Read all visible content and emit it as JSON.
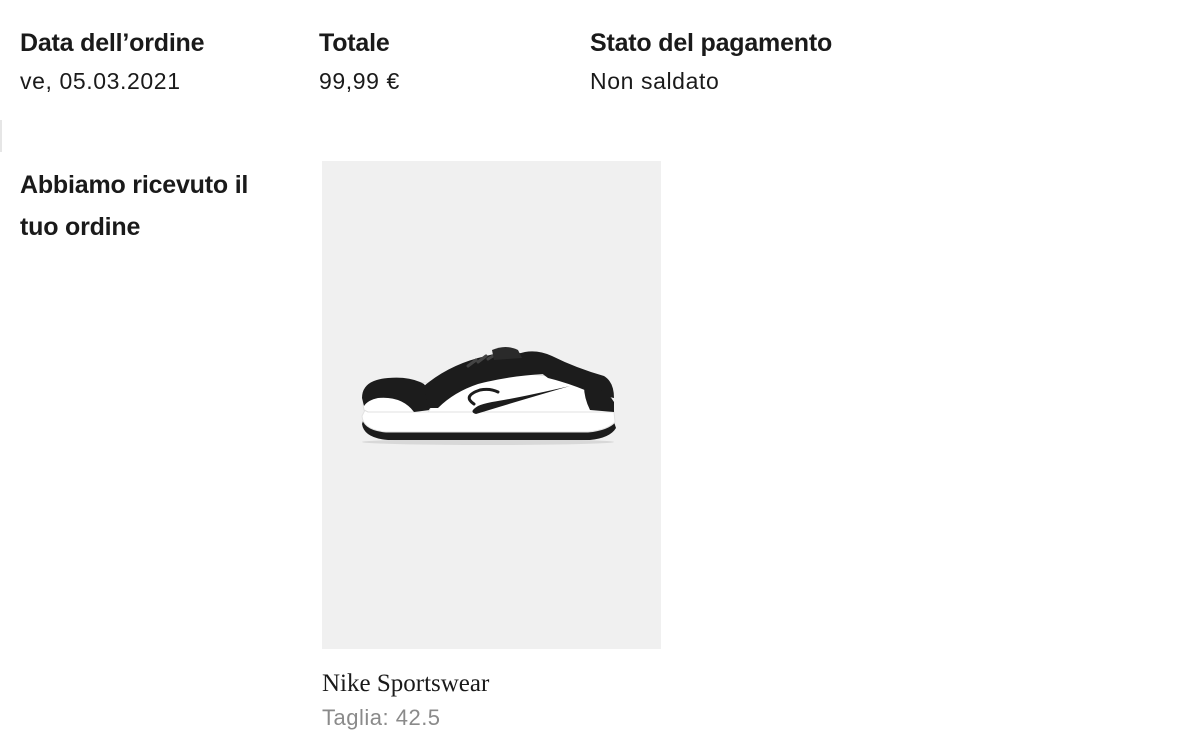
{
  "order_summary": {
    "date": {
      "label": "Data dell’ordine",
      "value": "ve, 05.03.2021"
    },
    "total": {
      "label": "Totale",
      "value": "99,99 €"
    },
    "payment": {
      "label": "Stato del pagamento",
      "value": "Non saldato"
    }
  },
  "status": {
    "heading": "Abbiamo ricevuto il tuo ordine"
  },
  "product": {
    "image_icon": "sneaker-product-image",
    "brand": "Nike Sportswear",
    "size_label": "Taglia:",
    "size_value": "42.5"
  },
  "colors": {
    "text": "#1a1a1a",
    "muted_text": "#8a8a8a",
    "image_background": "#f0f0f0"
  }
}
